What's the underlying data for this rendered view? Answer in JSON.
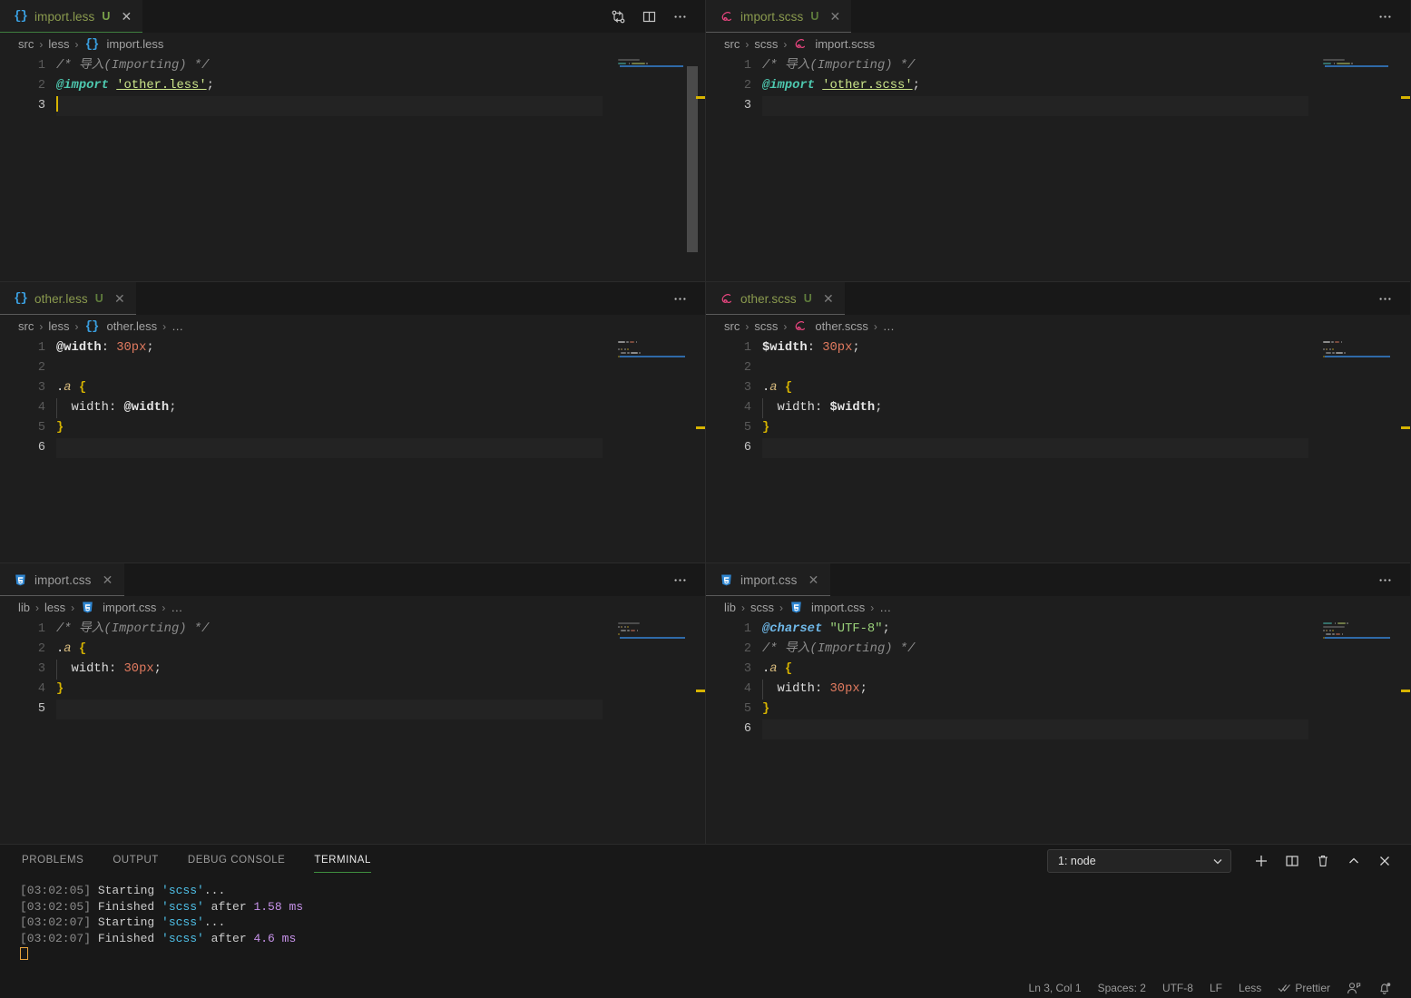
{
  "groups": [
    {
      "id": "top-left",
      "tab": {
        "label": "import.less",
        "badge": "U",
        "close": "✕",
        "icon": "less-file-icon",
        "kind": "less",
        "active": true
      },
      "breadcrumb": [
        "src",
        "less",
        "import.less"
      ],
      "breadcrumb_dots": "",
      "lines": [
        "1",
        "2",
        "3"
      ],
      "current_line": 3,
      "code": [
        {
          "tokens": [
            {
              "t": "/* 导入(Importing) */",
              "c": "c-com2"
            }
          ]
        },
        {
          "tokens": [
            {
              "t": "@import",
              "c": "c-at"
            },
            {
              "t": " ",
              "c": "c-punc"
            },
            {
              "t": "'other.less'",
              "c": "c-str-u"
            },
            {
              "t": ";",
              "c": "c-punc"
            }
          ]
        },
        {
          "tokens": [],
          "highlight": true,
          "caret": true
        }
      ]
    },
    {
      "id": "top-right",
      "tab": {
        "label": "import.scss",
        "badge": "U",
        "close": "✕",
        "icon": "scss-file-icon",
        "kind": "scss",
        "active": false
      },
      "breadcrumb": [
        "src",
        "scss",
        "import.scss"
      ],
      "breadcrumb_dots": "",
      "lines": [
        "1",
        "2",
        "3"
      ],
      "current_line": 3,
      "code": [
        {
          "tokens": [
            {
              "t": "/* 导入(Importing) */",
              "c": "c-com2"
            }
          ]
        },
        {
          "tokens": [
            {
              "t": "@import",
              "c": "c-at"
            },
            {
              "t": " ",
              "c": "c-punc"
            },
            {
              "t": "'other.scss'",
              "c": "c-str-u"
            },
            {
              "t": ";",
              "c": "c-punc"
            }
          ]
        },
        {
          "tokens": [],
          "highlight": true
        }
      ]
    },
    {
      "id": "mid-left",
      "tab": {
        "label": "other.less",
        "badge": "U",
        "close": "✕",
        "icon": "less-file-icon",
        "kind": "less",
        "active": false
      },
      "breadcrumb": [
        "src",
        "less",
        "other.less"
      ],
      "breadcrumb_dots": "…",
      "lines": [
        "1",
        "2",
        "3",
        "4",
        "5",
        "6"
      ],
      "current_line": 6,
      "code": [
        {
          "tokens": [
            {
              "t": "@width",
              "c": "c-var"
            },
            {
              "t": ": ",
              "c": "c-punc"
            },
            {
              "t": "30px",
              "c": "c-num"
            },
            {
              "t": ";",
              "c": "c-punc"
            }
          ]
        },
        {
          "tokens": []
        },
        {
          "tokens": [
            {
              "t": ".",
              "c": "c-sel"
            },
            {
              "t": "a",
              "c": "c-selp"
            },
            {
              "t": " ",
              "c": "c-punc"
            },
            {
              "t": "{",
              "c": "c-brace"
            }
          ]
        },
        {
          "tokens": [
            {
              "t": "  width",
              "c": "c-prop"
            },
            {
              "t": ": ",
              "c": "c-punc"
            },
            {
              "t": "@width",
              "c": "c-var"
            },
            {
              "t": ";",
              "c": "c-punc"
            }
          ],
          "guide": true
        },
        {
          "tokens": [
            {
              "t": "}",
              "c": "c-brace"
            }
          ]
        },
        {
          "tokens": [],
          "highlight": true
        }
      ]
    },
    {
      "id": "mid-right",
      "tab": {
        "label": "other.scss",
        "badge": "U",
        "close": "✕",
        "icon": "scss-file-icon",
        "kind": "scss",
        "active": false
      },
      "breadcrumb": [
        "src",
        "scss",
        "other.scss"
      ],
      "breadcrumb_dots": "…",
      "lines": [
        "1",
        "2",
        "3",
        "4",
        "5",
        "6"
      ],
      "current_line": 6,
      "code": [
        {
          "tokens": [
            {
              "t": "$width",
              "c": "c-var"
            },
            {
              "t": ": ",
              "c": "c-punc"
            },
            {
              "t": "30px",
              "c": "c-num"
            },
            {
              "t": ";",
              "c": "c-punc"
            }
          ]
        },
        {
          "tokens": []
        },
        {
          "tokens": [
            {
              "t": ".",
              "c": "c-sel"
            },
            {
              "t": "a",
              "c": "c-selp"
            },
            {
              "t": " ",
              "c": "c-punc"
            },
            {
              "t": "{",
              "c": "c-brace"
            }
          ]
        },
        {
          "tokens": [
            {
              "t": "  width",
              "c": "c-prop"
            },
            {
              "t": ": ",
              "c": "c-punc"
            },
            {
              "t": "$width",
              "c": "c-var"
            },
            {
              "t": ";",
              "c": "c-punc"
            }
          ],
          "guide": true
        },
        {
          "tokens": [
            {
              "t": "}",
              "c": "c-brace"
            }
          ]
        },
        {
          "tokens": [],
          "highlight": true
        }
      ]
    },
    {
      "id": "bot-left",
      "tab": {
        "label": "import.css",
        "badge": "",
        "close": "✕",
        "icon": "css-file-icon",
        "kind": "css",
        "active": false
      },
      "breadcrumb": [
        "lib",
        "less",
        "import.css"
      ],
      "breadcrumb_dots": "…",
      "lines": [
        "1",
        "2",
        "3",
        "4",
        "5"
      ],
      "current_line": 5,
      "code": [
        {
          "tokens": [
            {
              "t": "/* 导入(Importing) */",
              "c": "c-com2"
            }
          ]
        },
        {
          "tokens": [
            {
              "t": ".",
              "c": "c-sel"
            },
            {
              "t": "a",
              "c": "c-selp"
            },
            {
              "t": " ",
              "c": "c-punc"
            },
            {
              "t": "{",
              "c": "c-brace"
            }
          ]
        },
        {
          "tokens": [
            {
              "t": "  width",
              "c": "c-prop"
            },
            {
              "t": ": ",
              "c": "c-punc"
            },
            {
              "t": "30px",
              "c": "c-num"
            },
            {
              "t": ";",
              "c": "c-punc"
            }
          ],
          "guide": true
        },
        {
          "tokens": [
            {
              "t": "}",
              "c": "c-brace"
            }
          ]
        },
        {
          "tokens": [],
          "highlight": true
        }
      ]
    },
    {
      "id": "bot-right",
      "tab": {
        "label": "import.css",
        "badge": "",
        "close": "✕",
        "icon": "css-file-icon",
        "kind": "css",
        "active": false
      },
      "breadcrumb": [
        "lib",
        "scss",
        "import.css"
      ],
      "breadcrumb_dots": "…",
      "lines": [
        "1",
        "2",
        "3",
        "4",
        "5",
        "6"
      ],
      "current_line": 6,
      "code": [
        {
          "tokens": [
            {
              "t": "@charset",
              "c": "c-charset"
            },
            {
              "t": " ",
              "c": "c-punc"
            },
            {
              "t": "\"UTF-8\"",
              "c": "c-utf"
            },
            {
              "t": ";",
              "c": "c-punc"
            }
          ]
        },
        {
          "tokens": [
            {
              "t": "/* 导入(Importing) */",
              "c": "c-com2"
            }
          ]
        },
        {
          "tokens": [
            {
              "t": ".",
              "c": "c-sel"
            },
            {
              "t": "a",
              "c": "c-selp"
            },
            {
              "t": " ",
              "c": "c-punc"
            },
            {
              "t": "{",
              "c": "c-brace"
            }
          ]
        },
        {
          "tokens": [
            {
              "t": "  width",
              "c": "c-prop"
            },
            {
              "t": ": ",
              "c": "c-punc"
            },
            {
              "t": "30px",
              "c": "c-num"
            },
            {
              "t": ";",
              "c": "c-punc"
            }
          ],
          "guide": true
        },
        {
          "tokens": [
            {
              "t": "}",
              "c": "c-brace"
            }
          ]
        },
        {
          "tokens": [],
          "highlight": true
        }
      ]
    }
  ],
  "editor_actions": {
    "compare": "compare-changes-icon",
    "split": "split-editor-icon",
    "more": "⋯"
  },
  "panel": {
    "tabs": [
      {
        "label": "PROBLEMS",
        "active": false
      },
      {
        "label": "OUTPUT",
        "active": false
      },
      {
        "label": "DEBUG CONSOLE",
        "active": false
      },
      {
        "label": "TERMINAL",
        "active": true
      }
    ],
    "terminal_select": {
      "value": "1: node",
      "chevron": "⌄"
    },
    "actions": [
      {
        "name": "new-terminal-button",
        "glyph": "+"
      },
      {
        "name": "split-terminal-button",
        "glyph": "split"
      },
      {
        "name": "kill-terminal-button",
        "glyph": "trash"
      },
      {
        "name": "maximize-panel-button",
        "glyph": "⌃"
      },
      {
        "name": "close-panel-button",
        "glyph": "✕"
      }
    ],
    "terminal_lines": [
      [
        {
          "t": "[03:02:05]",
          "c": "t-time"
        },
        {
          "t": " Starting ",
          "c": ""
        },
        {
          "t": "'scss'",
          "c": "t-task"
        },
        {
          "t": "...",
          "c": ""
        }
      ],
      [
        {
          "t": "[03:02:05]",
          "c": "t-time"
        },
        {
          "t": " Finished ",
          "c": ""
        },
        {
          "t": "'scss'",
          "c": "t-task"
        },
        {
          "t": " after ",
          "c": ""
        },
        {
          "t": "1.58 ms",
          "c": "t-ms"
        }
      ],
      [
        {
          "t": "[03:02:07]",
          "c": "t-time"
        },
        {
          "t": " Starting ",
          "c": ""
        },
        {
          "t": "'scss'",
          "c": "t-task"
        },
        {
          "t": "...",
          "c": ""
        }
      ],
      [
        {
          "t": "[03:02:07]",
          "c": "t-time"
        },
        {
          "t": " Finished ",
          "c": ""
        },
        {
          "t": "'scss'",
          "c": "t-task"
        },
        {
          "t": " after ",
          "c": ""
        },
        {
          "t": "4.6 ms",
          "c": "t-ms"
        }
      ]
    ]
  },
  "statusbar": {
    "items": [
      {
        "name": "editor-position",
        "label": "Ln 3, Col 1"
      },
      {
        "name": "indentation",
        "label": "Spaces: 2"
      },
      {
        "name": "encoding",
        "label": "UTF-8"
      },
      {
        "name": "eol",
        "label": "LF"
      },
      {
        "name": "language-mode",
        "label": "Less"
      },
      {
        "name": "prettier-status",
        "label": "Prettier",
        "icon": "checkmarks-icon"
      },
      {
        "name": "remote-account",
        "label": "",
        "icon": "account-icon"
      },
      {
        "name": "notifications",
        "label": "",
        "icon": "bell-icon"
      }
    ]
  },
  "colors": {
    "bg": "#1e1e1e",
    "tabbar_bg": "#181818",
    "active_tab_border": "#3f7f3f",
    "inactive_tab_border": "#5a5a5a",
    "panel_bg": "#181818",
    "status_bg": "#181818",
    "caret": "#d7b400",
    "ruler_marker": "#d7b400"
  }
}
